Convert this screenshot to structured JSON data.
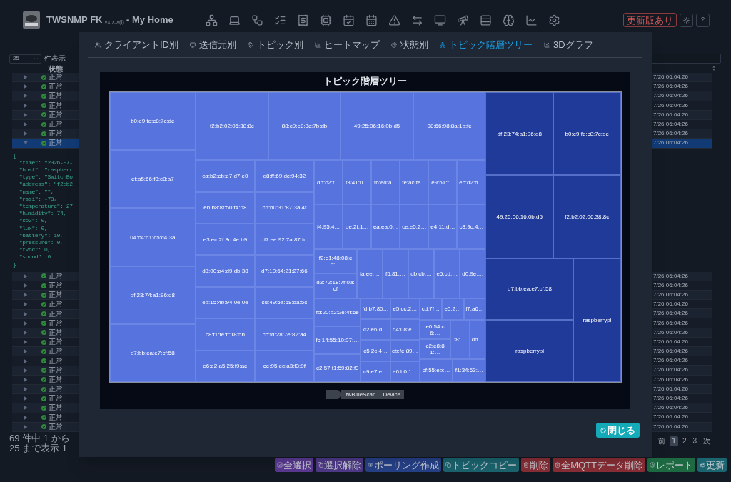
{
  "header": {
    "title": "TWSNMP FK",
    "version": "vx.x.x(l)",
    "subtitle": "- My Home",
    "update_button": "更新版あり",
    "help_button": "?"
  },
  "list_controls": {
    "page_size": "25",
    "page_size_label": "件表示"
  },
  "table": {
    "status_header": "状態",
    "rows": [
      {
        "status": "正常",
        "time": "7/26 06:04:26",
        "expanded": false,
        "selected": false
      },
      {
        "status": "正常",
        "time": "7/26 06:04:26",
        "expanded": false,
        "selected": false
      },
      {
        "status": "正常",
        "time": "7/26 06:04:26",
        "expanded": false,
        "selected": false
      },
      {
        "status": "正常",
        "time": "7/26 06:04:26",
        "expanded": false,
        "selected": false
      },
      {
        "status": "正常",
        "time": "7/26 06:04:26",
        "expanded": false,
        "selected": false
      },
      {
        "status": "正常",
        "time": "7/26 06:04:26",
        "expanded": false,
        "selected": false
      },
      {
        "status": "正常",
        "time": "7/26 06:04:26",
        "expanded": false,
        "selected": false
      },
      {
        "status": "正常",
        "time": "7/26 06:04:26",
        "expanded": true,
        "selected": true,
        "detail": [
          "{",
          "  \"time\": \"2026-07-",
          "  \"host\": \"raspberr",
          "  \"type\": \"SwitchBo",
          "  \"address\": \"f2:b2",
          "  \"name\": \"\",",
          "  \"rssi\": -78,",
          "  \"temperature\": 27",
          "  \"humidity\": 74,",
          "  \"co2\": 0,",
          "  \"lux\": 0,",
          "  \"battery\": 10,",
          "  \"pressure\": 0,",
          "  \"tvoc\": 0,",
          "  \"sound\": 0",
          "}"
        ]
      },
      {
        "status": "正常",
        "time": "7/26 06:04:26",
        "expanded": false,
        "selected": false
      },
      {
        "status": "正常",
        "time": "7/26 06:04:26",
        "expanded": false,
        "selected": false
      },
      {
        "status": "正常",
        "time": "7/26 06:04:26",
        "expanded": false,
        "selected": false
      },
      {
        "status": "正常",
        "time": "7/26 06:04:26",
        "expanded": false,
        "selected": false
      },
      {
        "status": "正常",
        "time": "7/26 06:04:26",
        "expanded": false,
        "selected": false
      },
      {
        "status": "正常",
        "time": "7/26 06:04:26",
        "expanded": false,
        "selected": false
      },
      {
        "status": "正常",
        "time": "7/26 06:04:26",
        "expanded": false,
        "selected": false
      },
      {
        "status": "正常",
        "time": "7/26 06:04:26",
        "expanded": false,
        "selected": false
      },
      {
        "status": "正常",
        "time": "7/26 06:04:26",
        "expanded": false,
        "selected": false
      },
      {
        "status": "正常",
        "time": "7/26 06:04:26",
        "expanded": false,
        "selected": false
      },
      {
        "status": "正常",
        "time": "7/26 06:04:26",
        "expanded": false,
        "selected": false
      },
      {
        "status": "正常",
        "time": "7/26 06:04:26",
        "expanded": false,
        "selected": false
      },
      {
        "status": "正常",
        "time": "7/26 06:04:26",
        "expanded": false,
        "selected": false
      },
      {
        "status": "正常",
        "time": "7/26 06:04:26",
        "expanded": false,
        "selected": false
      },
      {
        "status": "正常",
        "time": "7/26 06:04:26",
        "expanded": false,
        "selected": false
      },
      {
        "status": "正常",
        "time": "7/26 06:04:26",
        "expanded": false,
        "selected": false
      },
      {
        "status": "正常",
        "time": "7/26 06:04:26",
        "expanded": false,
        "selected": false
      }
    ],
    "footer": "69 件中 1 から 25 まで表示 1",
    "pagination": [
      {
        "label": "前",
        "selected": false
      },
      {
        "label": "1",
        "selected": true
      },
      {
        "label": "2",
        "selected": false
      },
      {
        "label": "3",
        "selected": false
      },
      {
        "label": "次",
        "selected": false
      }
    ]
  },
  "actions": [
    {
      "label": "全選択",
      "color": "#5b3a94"
    },
    {
      "label": "選択解除",
      "color": "#4f3a8a"
    },
    {
      "label": "ポーリング作成",
      "color": "#27428a"
    },
    {
      "label": "トピックコピー",
      "color": "#1b6570"
    },
    {
      "label": "削除",
      "color": "#8a2e36"
    },
    {
      "label": "全MQTTデータ削除",
      "color": "#8a2e36"
    },
    {
      "label": "レポート",
      "color": "#1d6a42"
    },
    {
      "label": "更新",
      "color": "#1b6570"
    }
  ],
  "dialog": {
    "tabs": [
      {
        "label": "クライアントID別",
        "selected": false
      },
      {
        "label": "送信元別",
        "selected": false
      },
      {
        "label": "トピック別",
        "selected": false
      },
      {
        "label": "ヒートマップ",
        "selected": false
      },
      {
        "label": "状態別",
        "selected": false
      },
      {
        "label": "トピック階層ツリー",
        "selected": true
      },
      {
        "label": "3Dグラフ",
        "selected": false
      }
    ],
    "treemap": {
      "title": "トピック階層ツリー",
      "nodes": [
        {
          "color": "#5673de",
          "children": [
            {
              "children": [
                {
                  "label": "b0:e9:fe:c8:7c:de"
                },
                {
                  "label": "ef:a5:66:f8:c8:a7"
                },
                {
                  "label": "04:c4:61:c5:c4:3a"
                },
                {
                  "label": "df:23:74:a1:96:d8"
                },
                {
                  "label": "d7:bb:ea:e7:cf:58"
                }
              ]
            },
            {
              "children": [
                {
                  "children": [
                    {
                      "label": "f2:b2:02:06:38:8c"
                    },
                    {
                      "label": "88:c9:e8:8c:7b:db"
                    },
                    {
                      "label": "49:25:06:16:0b:d5"
                    },
                    {
                      "label": "08:66:98:8a:1b:fe"
                    }
                  ]
                },
                {
                  "children": [
                    {
                      "children": [
                        {
                          "label": "ca:b2:eb:e7:d7:e0"
                        },
                        {
                          "label": "eb:b8:8f:50:f4:68"
                        },
                        {
                          "label": "e3:ec:2f:8c:4e:b9"
                        },
                        {
                          "label": "d8:00:a4:d9:db:38"
                        },
                        {
                          "label": "eb:15:4b:94:0e:0e"
                        },
                        {
                          "label": "c8:f1:fe:ff:18:5b"
                        },
                        {
                          "label": "e6:e2:a5:25:f9:ae"
                        }
                      ]
                    },
                    {
                      "children": [
                        {
                          "label": "d8:ff:69:dc:94:32"
                        },
                        {
                          "label": "c5:b0:31:87:3a:4f"
                        },
                        {
                          "label": "d7:ee:92:7a:87:fc"
                        },
                        {
                          "label": "d7:10:64:21:27:66"
                        },
                        {
                          "label": "cd:49:5a:58:da:5c"
                        },
                        {
                          "label": "cc:fd:28:7e:82:a4"
                        },
                        {
                          "label": "ce:95:ec:a3:f3:9f"
                        }
                      ]
                    },
                    {
                      "children": [
                        {
                          "children": [
                            {
                              "children": [
                                {
                                  "label": "db:c2:f…"
                                },
                                {
                                  "label": "f3:41:0…"
                                },
                                {
                                  "label": "f6:ed:a…"
                                },
                                {
                                  "label": "fe:ac:fe…"
                                },
                                {
                                  "label": "e9:51:f…"
                                },
                                {
                                  "label": "ec:d2:b…"
                                }
                              ]
                            },
                            {
                              "children": [
                                {
                                  "label": "f4:95:4…"
                                },
                                {
                                  "label": "de:2f:1…"
                                },
                                {
                                  "label": "ea:ea:0…"
                                },
                                {
                                  "label": "ce:e5:2…"
                                },
                                {
                                  "label": "e4:11:d…"
                                },
                                {
                                  "label": "c8:9c:4…"
                                }
                              ]
                            }
                          ]
                        },
                        {
                          "children": [
                            {
                              "children": [
                                {
                                  "label": "f2:e1:48:08:c6:…"
                                },
                                {
                                  "label": "d3:72:18:7f:0a:cf"
                                }
                              ]
                            },
                            {
                              "label": "fa:ee:…"
                            },
                            {
                              "label": "f5:81:…"
                            },
                            {
                              "label": "db:cb:…"
                            },
                            {
                              "label": "e5:cd:…"
                            },
                            {
                              "label": "d0:9e:…"
                            }
                          ]
                        },
                        {
                          "children": [
                            {
                              "children": [
                                {
                                  "label": "fd:20:b2:2e:4f:6e"
                                },
                                {
                                  "label": "fc:14:55:10:07:…"
                                },
                                {
                                  "label": "c2:57:f1:59:82:f3"
                                }
                              ]
                            },
                            {
                              "children": [
                                {
                                  "children": [
                                    {
                                      "label": "fd:b7:80…"
                                    },
                                    {
                                      "label": "e5:cc:2…"
                                    }
                                  ]
                                },
                                {
                                  "children": [
                                    {
                                      "label": "c2:e6:d…"
                                    },
                                    {
                                      "label": "d4:08:e…"
                                    }
                                  ]
                                },
                                {
                                  "children": [
                                    {
                                      "label": "c5:2c:4…"
                                    },
                                    {
                                      "label": "cb:fe:89…"
                                    }
                                  ]
                                },
                                {
                                  "children": [
                                    {
                                      "label": "c9:e7:e…"
                                    },
                                    {
                                      "label": "e6:b0:1…"
                                    }
                                  ]
                                }
                              ]
                            },
                            {
                              "children": [
                                {
                                  "children": [
                                    {
                                      "label": "cd:7f…"
                                    },
                                    {
                                      "label": "e0:2…"
                                    },
                                    {
                                      "label": "f7:a6…"
                                    }
                                  ]
                                },
                                {
                                  "children": [
                                    {
                                      "children": [
                                        {
                                          "label": "e0:54:c6:…"
                                        },
                                        {
                                          "label": "c2:e8:81:…"
                                        }
                                      ]
                                    },
                                    {
                                      "label": "f8:…"
                                    },
                                    {
                                      "label": "dd…"
                                    }
                                  ]
                                },
                                {
                                  "children": [
                                    {
                                      "label": "cf:55:eb:…"
                                    },
                                    {
                                      "label": "f1:34:63:…"
                                    }
                                  ]
                                }
                              ]
                            }
                          ]
                        }
                      ]
                    }
                  ]
                }
              ]
            }
          ]
        },
        {
          "color": "#1f3a99",
          "children": [
            {
              "children": [
                {
                  "children": [
                    {
                      "label": "df:23:74:a1:96:d8"
                    },
                    {
                      "label": "49:25:06:16:0b:d5"
                    }
                  ]
                },
                {
                  "children": [
                    {
                      "label": "b0:e9:fe:c8:7c:de"
                    },
                    {
                      "label": "f2:b2:02:06:38:8c"
                    }
                  ]
                }
              ]
            },
            {
              "children": [
                {
                  "children": [
                    {
                      "label": "d7:bb:ea:e7:cf:58"
                    },
                    {
                      "label": "raspberrypi"
                    }
                  ]
                },
                {
                  "label": "raspberrypi"
                }
              ]
            }
          ]
        }
      ],
      "breadcrumb": [
        "twBlueScan",
        "Device"
      ]
    },
    "close_button": "閉じる"
  }
}
